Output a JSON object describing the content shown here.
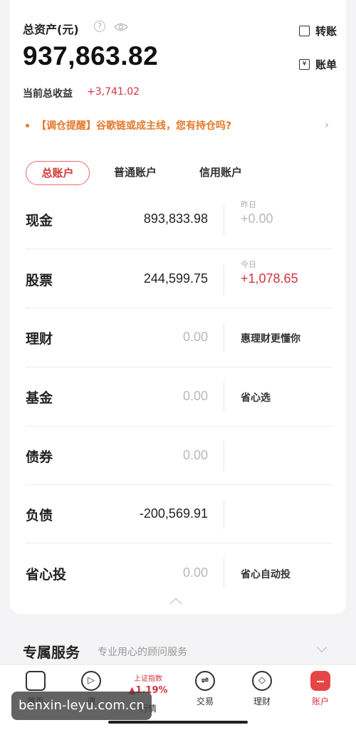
{
  "header": {
    "title": "总资产(元)",
    "help_icon": "question-circle-icon",
    "help_glyph": "?",
    "eye_icon": "eye-icon",
    "total": "937,863.82",
    "income_label": "当前总收益",
    "income_value": "+3,741.02",
    "transfer_label": "转账",
    "bill_label": "账单",
    "bill_glyph": "¥"
  },
  "notice": {
    "text": "【调仓提醒】谷歌链或成主线，您有持仓吗?",
    "arrow": "›"
  },
  "tabs": [
    {
      "label": "总账户",
      "active": true
    },
    {
      "label": "普通账户",
      "active": false
    },
    {
      "label": "信用账户",
      "active": false
    }
  ],
  "rows": {
    "cash": {
      "name": "现金",
      "value": "893,833.98",
      "sub_label": "昨日",
      "extra": "+0.00"
    },
    "stock": {
      "name": "股票",
      "value": "244,599.75",
      "sub_label": "今日",
      "extra": "+1,078.65"
    },
    "wealth": {
      "name": "理财",
      "value": "0.00",
      "link": "惠理财更懂你"
    },
    "fund": {
      "name": "基金",
      "value": "0.00",
      "link": "省心选"
    },
    "bond": {
      "name": "债券",
      "value": "0.00"
    },
    "debt": {
      "name": "负债",
      "value": "-200,569.91"
    },
    "invest": {
      "name": "省心投",
      "value": "0.00",
      "link": "省心自动投"
    }
  },
  "service": {
    "title": "专属服务",
    "subtitle": "专业用心的顾问服务"
  },
  "nav": {
    "items": [
      {
        "label": "首页",
        "icon": "home-icon"
      },
      {
        "label": "课",
        "icon": "play-icon"
      },
      {
        "label": "行情",
        "icon": "market-icon",
        "index_name": "上证指数",
        "index_value": "▲1.19%"
      },
      {
        "label": "交易",
        "icon": "trade-icon",
        "glyph": "⇌"
      },
      {
        "label": "理财",
        "icon": "wealth-icon",
        "glyph": "◇"
      },
      {
        "label": "账户",
        "icon": "account-icon"
      }
    ]
  },
  "watermark": "benxin-leyu.com.cn",
  "colors": {
    "accent": "#d0343f",
    "notice": "#e5782b"
  }
}
